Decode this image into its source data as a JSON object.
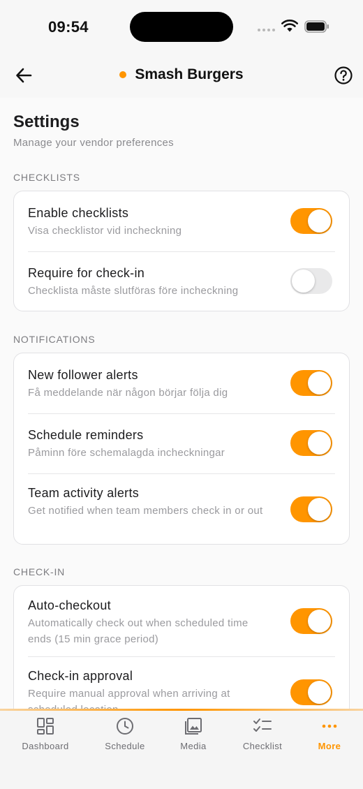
{
  "status": {
    "time": "09:54"
  },
  "nav": {
    "title": "Smash Burgers"
  },
  "page": {
    "title": "Settings",
    "subtitle": "Manage your vendor preferences"
  },
  "sections": [
    {
      "label": "CHECKLISTS",
      "rows": [
        {
          "title": "Enable checklists",
          "subtitle": "Visa checklistor vid incheckning",
          "on": true
        },
        {
          "title": "Require for check-in",
          "subtitle": "Checklista måste slutföras före incheckning",
          "on": false
        }
      ]
    },
    {
      "label": "NOTIFICATIONS",
      "rows": [
        {
          "title": "New follower alerts",
          "subtitle": "Få meddelande när någon börjar följa dig",
          "on": true
        },
        {
          "title": "Schedule reminders",
          "subtitle": "Påminn före schemalagda incheckningar",
          "on": true
        },
        {
          "title": "Team activity alerts",
          "subtitle": "Get notified when team members check in or out",
          "on": true
        }
      ]
    },
    {
      "label": "CHECK-IN",
      "rows": [
        {
          "title": "Auto-checkout",
          "subtitle": "Automatically check out when scheduled time ends (15 min grace period)",
          "on": true
        },
        {
          "title": "Check-in approval",
          "subtitle": "Require manual approval when arriving at scheduled location",
          "on": true
        }
      ]
    }
  ],
  "tabs": [
    {
      "label": "Dashboard",
      "icon": "dashboard-icon"
    },
    {
      "label": "Schedule",
      "icon": "clock-icon"
    },
    {
      "label": "Media",
      "icon": "image-icon"
    },
    {
      "label": "Checklist",
      "icon": "checklist-icon"
    },
    {
      "label": "More",
      "icon": "more-icon",
      "active": true
    }
  ],
  "colors": {
    "accent": "#ff9500",
    "toggle_off": "#e9e9ea"
  }
}
